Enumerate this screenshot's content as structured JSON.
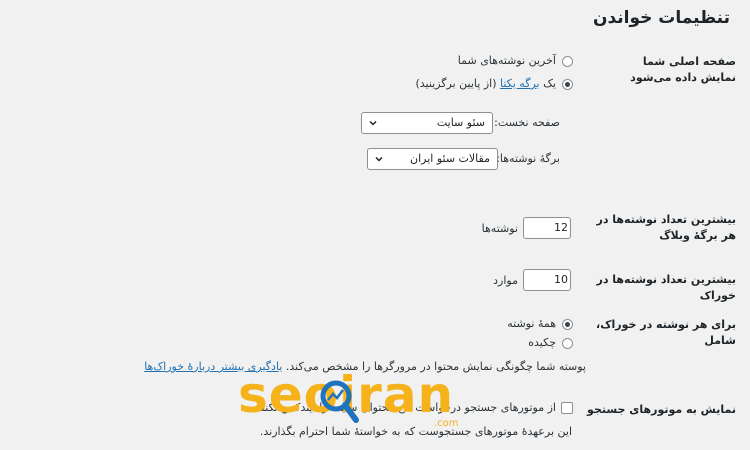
{
  "page": {
    "title": "تنظیمات خواندن"
  },
  "homepage": {
    "label": "صفحه اصلی شما نمایش داده می‌شود",
    "option_latest": "آخرین نوشته‌های شما",
    "option_static_prefix": "یک",
    "option_static_link": "برگه یکتا",
    "option_static_suffix": "(از پایین برگزینید)",
    "front_label": "صفحه نخست:",
    "front_value": "سئو سایت",
    "posts_label": "برگهٔ نوشته‌ها:",
    "posts_value": "مقالات سئو ایران"
  },
  "blog_pages": {
    "label": "بیشترین تعداد نوشته‌ها در هر برگهٔ وبلاگ",
    "value": "12",
    "unit": "نوشته‌ها"
  },
  "feed_items": {
    "label": "بیشترین تعداد نوشته‌ها در خوراک",
    "value": "10",
    "unit": "موارد"
  },
  "feed_content": {
    "label": "برای هر نوشته در خوراک، شامل",
    "option_full": "همهٔ نوشته",
    "option_excerpt": "چکیده",
    "description": "پوسته شما چگونگی نمایش محتوا در مرورگرها را مشخص می‌کند.",
    "learn_more": "یادگیری بیشتر دربارهٔ خوراک‌ها"
  },
  "search_engines": {
    "label": "نمایش به موتورهای جستجو",
    "checkbox_label": "از موتورهای جستجو درخواست کن محتوای سایت را ایندکس نکنند",
    "note": "این برعهدهٔ موتورهای جستجوست که به خواستهٔ شما احترام بگذارند."
  },
  "watermark": {
    "brand": "seoiran",
    "suffix": ".com"
  },
  "colors": {
    "background": "#f1f1f1",
    "link": "#2271b1",
    "brand": "#f5b21b",
    "brand_blue": "#1e73be"
  }
}
